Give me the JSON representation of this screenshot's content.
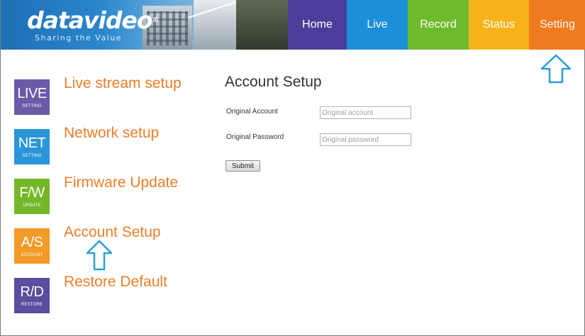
{
  "header": {
    "logo": "datavideo",
    "tagline": "Sharing the Value"
  },
  "nav": {
    "home": "Home",
    "live": "Live",
    "record": "Record",
    "status": "Status",
    "setting": "Setting"
  },
  "sidebar": {
    "items": [
      {
        "tile": "LIVE",
        "sub": "SETTING",
        "label": "Live stream setup",
        "color": "#6a5aa8"
      },
      {
        "tile": "NET",
        "sub": "SETTING",
        "label": "Network setup",
        "color": "#2a95d8"
      },
      {
        "tile": "F/W",
        "sub": "UPDATE",
        "label": "Firmware Update",
        "color": "#74b82a"
      },
      {
        "tile": "A/S",
        "sub": "ACCOUNT",
        "label": "Account Setup",
        "color": "#f39a28"
      },
      {
        "tile": "R/D",
        "sub": "RESTORE",
        "label": "Restore Default",
        "color": "#5a4e9e"
      }
    ]
  },
  "form": {
    "title": "Account Setup",
    "account_label": "Original Account",
    "account_placeholder": "Original account",
    "password_label": "Original Password",
    "password_placeholder": "Original password",
    "submit": "Submit"
  },
  "colors": {
    "accent_orange": "#ee7d2a",
    "annotation_arrow": "#2a9fd6"
  }
}
